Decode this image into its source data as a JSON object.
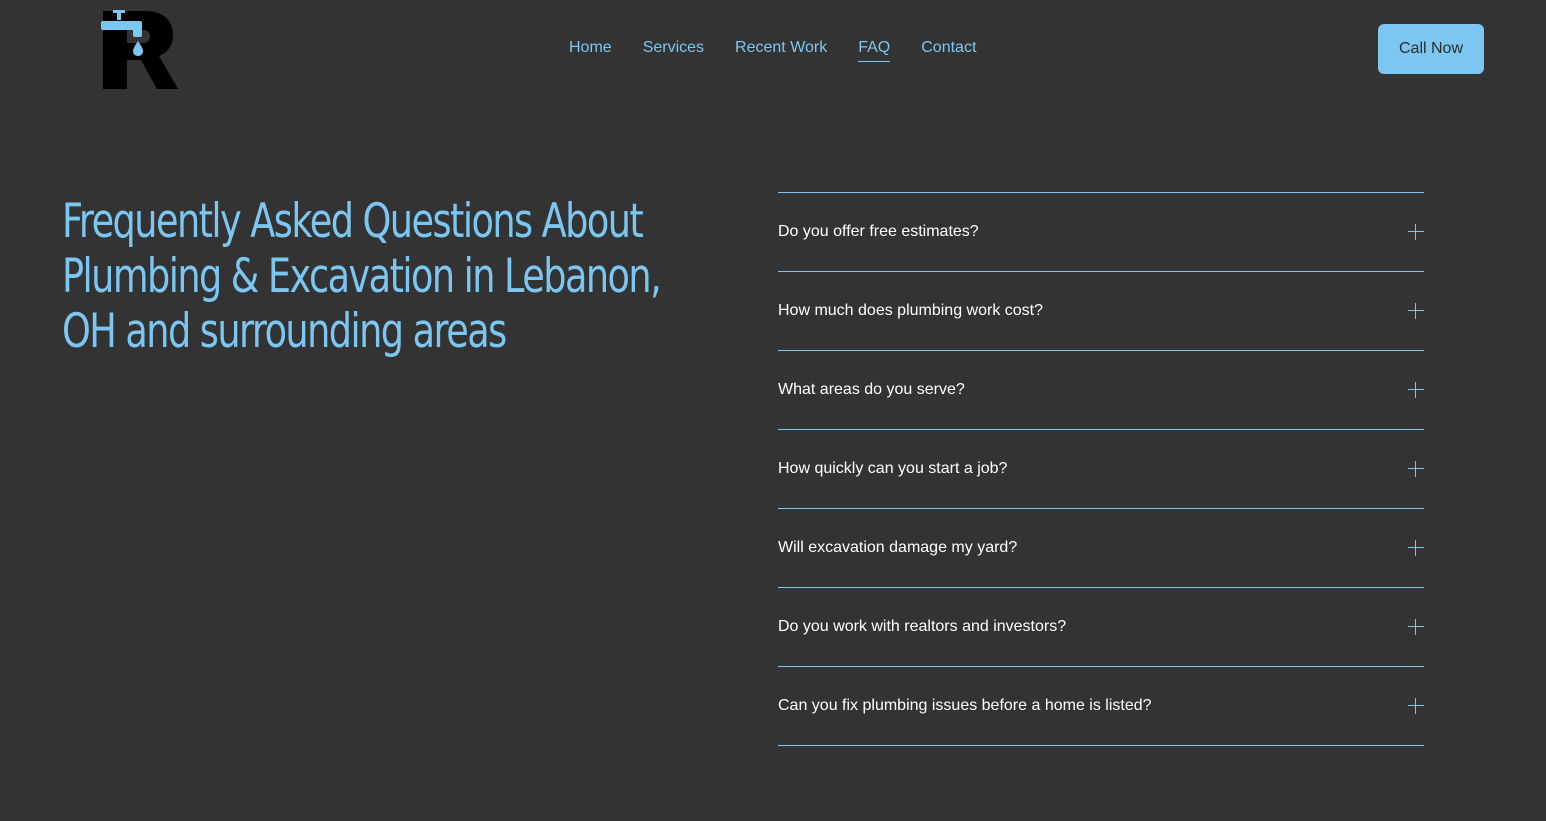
{
  "header": {
    "logo_icon": "faucet-R-logo-icon",
    "nav": [
      {
        "label": "Home"
      },
      {
        "label": "Services"
      },
      {
        "label": "Recent Work"
      },
      {
        "label": "FAQ",
        "active": true
      },
      {
        "label": "Contact"
      }
    ],
    "cta_label": "Call Now"
  },
  "main": {
    "title": "Frequently Asked Questions About Plumbing & Excavation in Lebanon, OH and surrounding areas",
    "faq": [
      {
        "question": "Do you offer free estimates?"
      },
      {
        "question": "How much does plumbing work cost?"
      },
      {
        "question": "What areas do you serve?"
      },
      {
        "question": "How quickly can you start a job?"
      },
      {
        "question": "Will excavation damage my yard?"
      },
      {
        "question": "Do you work with realtors and investors?"
      },
      {
        "question": "Can you fix plumbing issues before a home is listed?"
      }
    ]
  },
  "colors": {
    "background": "#333333",
    "accent": "#7cc7f2",
    "text": "#ffffff"
  }
}
